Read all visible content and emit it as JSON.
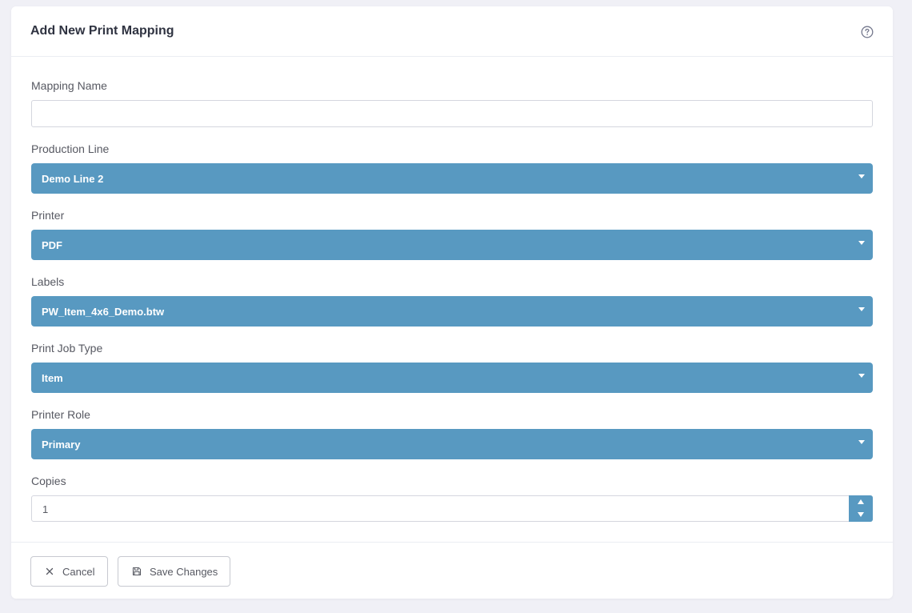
{
  "header": {
    "title": "Add New Print Mapping"
  },
  "form": {
    "mapping_name": {
      "label": "Mapping Name",
      "value": ""
    },
    "production_line": {
      "label": "Production Line",
      "value": "Demo Line 2"
    },
    "printer": {
      "label": "Printer",
      "value": "PDF"
    },
    "labels": {
      "label": "Labels",
      "value": "PW_Item_4x6_Demo.btw"
    },
    "print_job_type": {
      "label": "Print Job Type",
      "value": "Item"
    },
    "printer_role": {
      "label": "Printer Role",
      "value": "Primary"
    },
    "copies": {
      "label": "Copies",
      "value": "1"
    }
  },
  "footer": {
    "cancel_label": "Cancel",
    "save_label": "Save Changes"
  },
  "colors": {
    "select_bg": "#5899c1",
    "page_bg": "#f0f0f6"
  },
  "icons": {
    "help": "question-circle-icon",
    "cancel": "close-icon",
    "save": "floppy-disk-icon"
  }
}
